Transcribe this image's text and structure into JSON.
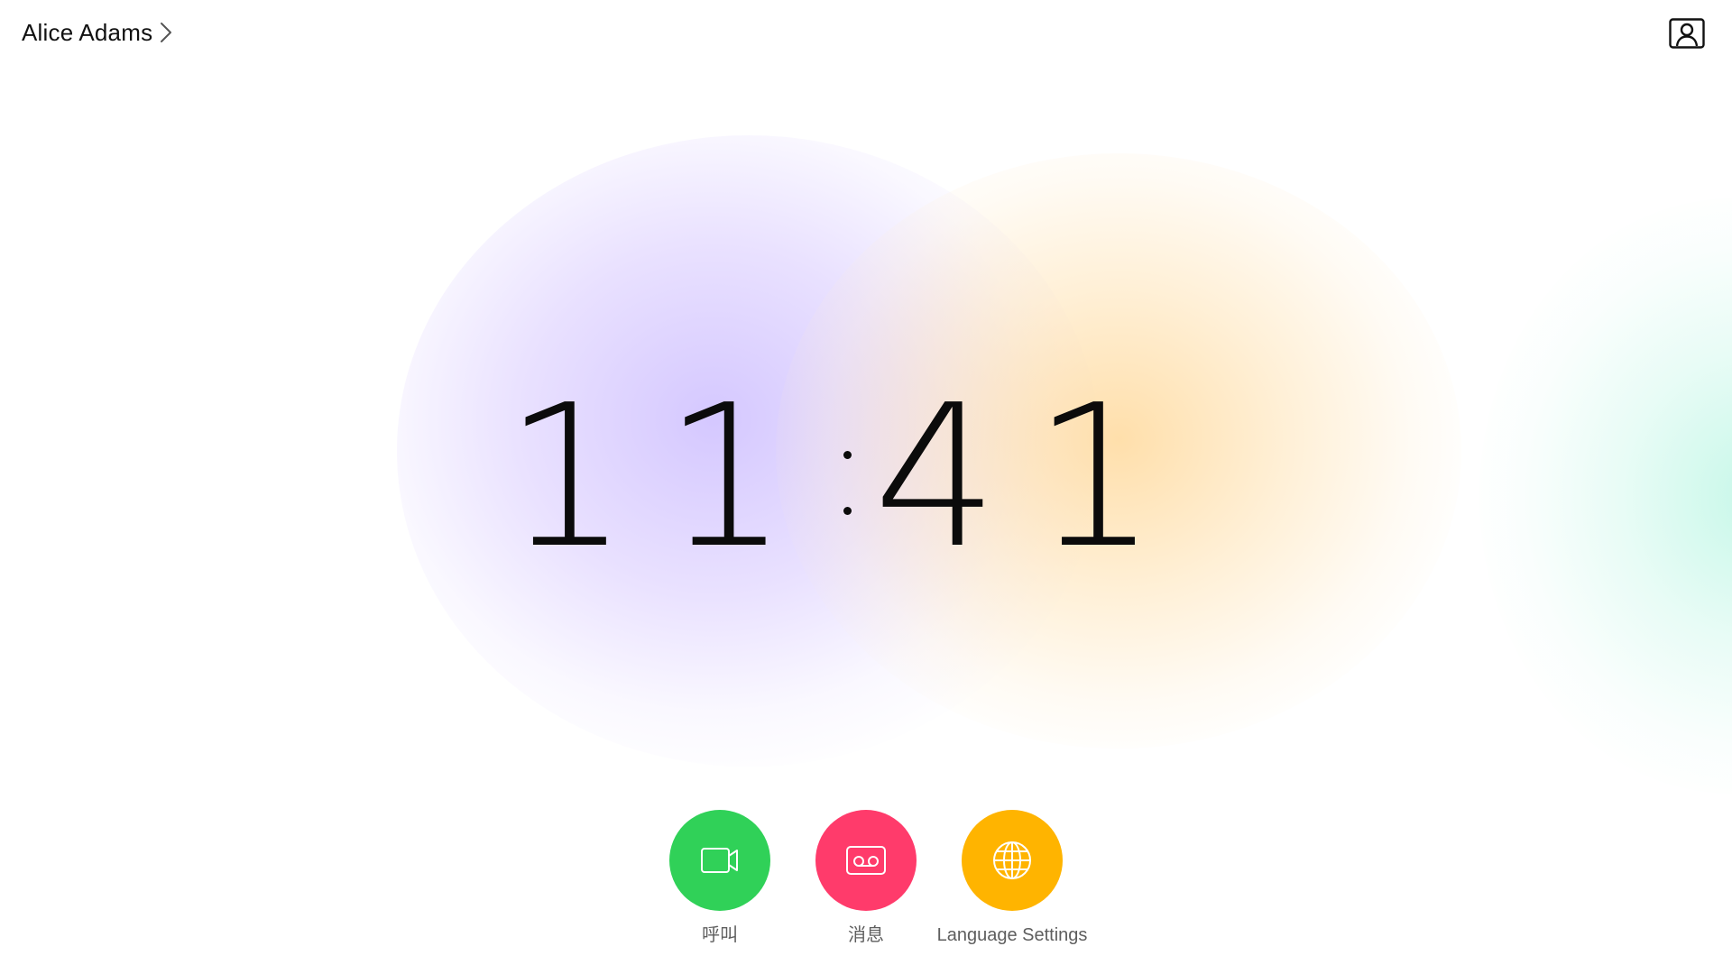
{
  "header": {
    "user_name": "Alice Adams",
    "chevron_icon": "chevron-right-icon",
    "profile_icon": "user-profile-icon"
  },
  "clock": {
    "hours": "11",
    "minutes": "41"
  },
  "actions": [
    {
      "label": "呼叫",
      "icon": "video-camera-icon",
      "color": "#30D158"
    },
    {
      "label": "消息",
      "icon": "voicemail-icon",
      "color": "#FF3B6B"
    },
    {
      "label": "Language Settings",
      "icon": "globe-icon",
      "color": "#FFB400"
    }
  ],
  "colors": {
    "background": "#FFFFFF",
    "text": "#111111",
    "label_text": "#5E5E5E",
    "glow_purple": "#D6CCFF",
    "glow_orange": "#FFDCA8",
    "glow_mint": "#C8F5E6"
  }
}
